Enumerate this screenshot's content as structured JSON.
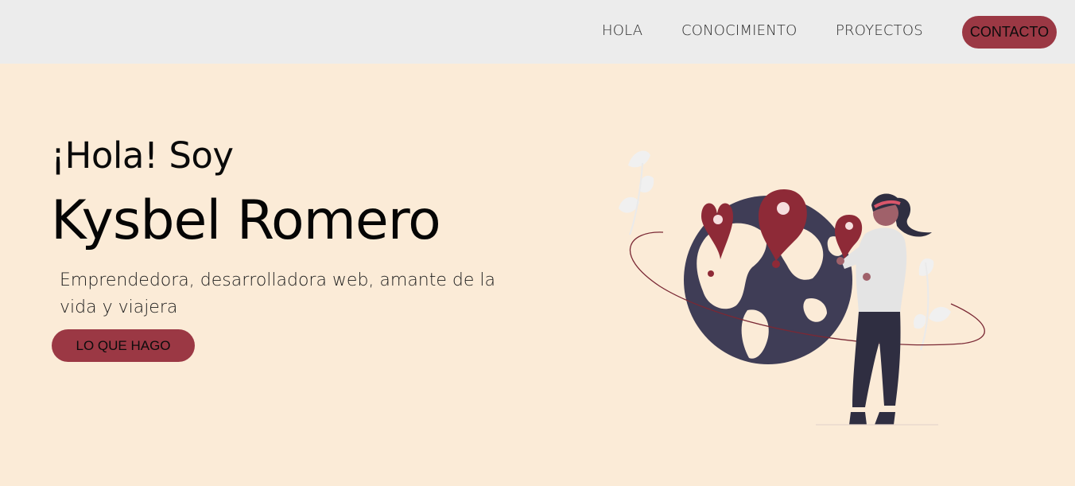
{
  "nav": {
    "links": [
      "HOLA",
      "CONOCIMIENTO",
      "PROYECTOS"
    ],
    "contact": "CONTACTO"
  },
  "hero": {
    "greeting": "¡Hola! Soy",
    "name": "Kysbel Romero",
    "tagline": "Emprendedora, desarrolladora web, amante de la vida y viajera",
    "cta": "LO QUE HAGO"
  },
  "colors": {
    "accent": "#9b3844",
    "background": "#fbebd7",
    "navbar": "#ececec",
    "globe": "#3f3d56"
  },
  "illustration": {
    "icons": [
      "globe-icon",
      "map-pin-icon",
      "leaf-icon"
    ]
  }
}
